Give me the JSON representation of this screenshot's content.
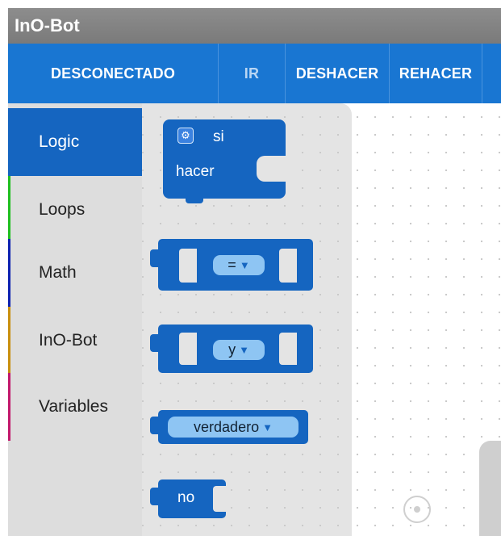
{
  "app": {
    "title": "InO-Bot"
  },
  "toolbar": {
    "connection_label": "DESCONECTADO",
    "run_label": "IR",
    "undo_label": "DESHACER",
    "redo_label": "REHACER"
  },
  "toolbox": {
    "categories": [
      {
        "label": "Logic",
        "color": "#1565c0",
        "selected": true
      },
      {
        "label": "Loops",
        "color": "#1fbf1f",
        "selected": false
      },
      {
        "label": "Math",
        "color": "#0d21b0",
        "selected": false
      },
      {
        "label": "InO-Bot",
        "color": "#c98f0e",
        "selected": false
      },
      {
        "label": "Variables",
        "color": "#c2186b",
        "selected": false
      }
    ]
  },
  "flyout": {
    "if_block": {
      "if_label": "si",
      "do_label": "hacer",
      "icon": "gear-icon"
    },
    "compare_block": {
      "operator": "=",
      "arrow": "▼"
    },
    "logic_op_block": {
      "operator": "y",
      "arrow": "▼"
    },
    "boolean_block": {
      "value": "verdadero",
      "arrow": "▼"
    },
    "negate_block": {
      "label": "no"
    }
  },
  "colors": {
    "accent": "#1976d2",
    "block": "#1565c0",
    "pill": "#8ec5f3"
  }
}
